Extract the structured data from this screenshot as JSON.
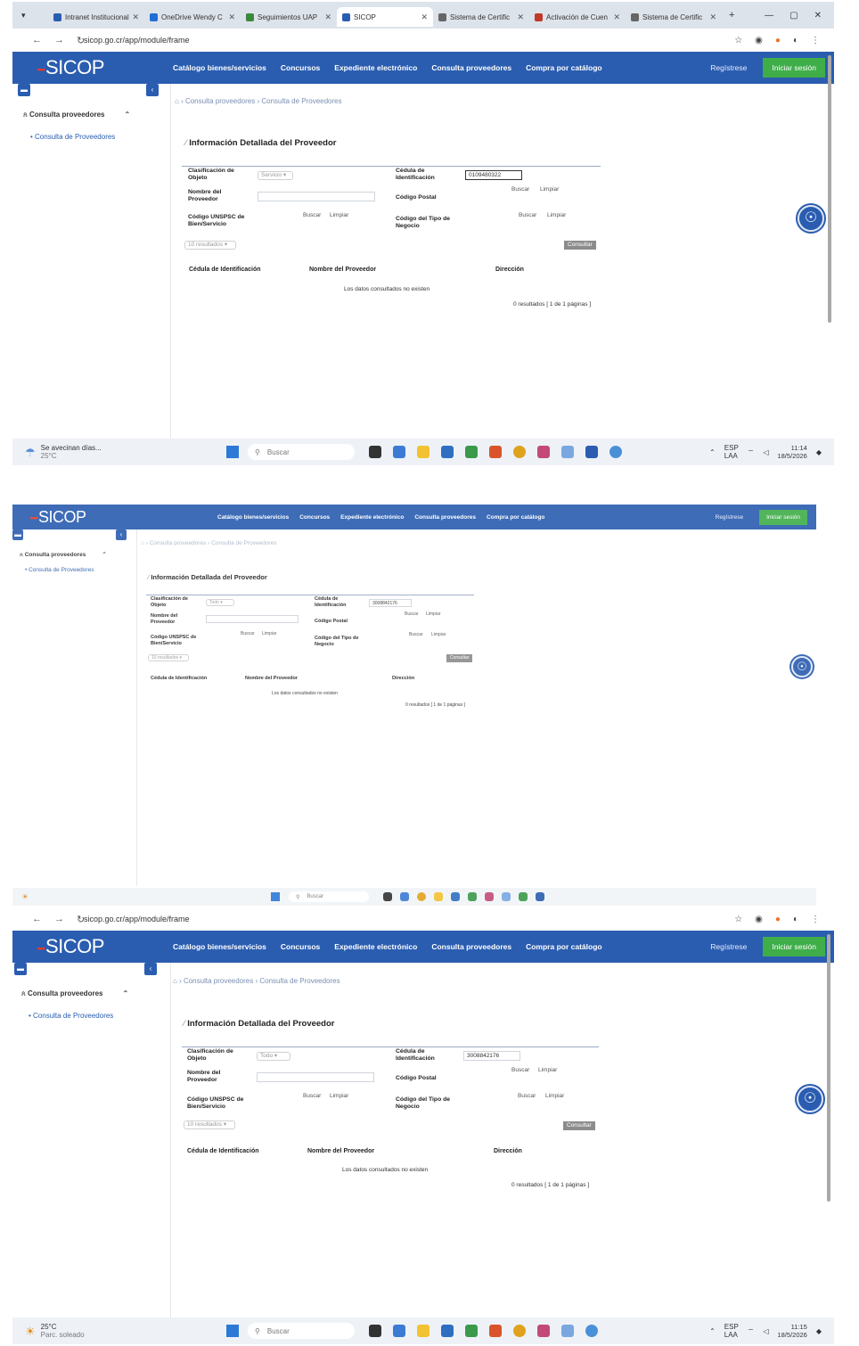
{
  "browser": {
    "tabs": [
      {
        "label": "Intranet Institucional",
        "color": "#2a5db0"
      },
      {
        "label": "OneDrive Wendy C",
        "color": "#1f6fd6"
      },
      {
        "label": "Seguimientos UAP",
        "color": "#3b8a3b"
      },
      {
        "label": "SICOP",
        "color": "#2a5db0"
      },
      {
        "label": "Sistema de Certific",
        "color": "#666666"
      },
      {
        "label": "Activación de Cuen",
        "color": "#c0392b"
      },
      {
        "label": "Sistema de Certific",
        "color": "#666666"
      }
    ],
    "url": "sicop.go.cr/app/module/frame"
  },
  "sicop": {
    "logo": "SICOP",
    "menu": [
      "Catálogo bienes/servicios",
      "Concursos",
      "Expediente electrónico",
      "Consulta proveedores",
      "Compra por catálogo"
    ],
    "register": "Regístrese",
    "login": "Iniciar sesión",
    "sidebar_section": "Consulta proveedores",
    "sidebar_link": "Consulta de Proveedores",
    "breadcrumb": [
      "Consulta proveedores",
      "Consulta de Proveedores"
    ],
    "page_title": "Información Detallada del Proveedor"
  },
  "form": {
    "clasificacion_label": "Clasificación de Objeto",
    "nombre_label": "Nombre del Proveedor",
    "unspsc_label": "Código UNSPSC de Bien/Servicio",
    "cedula_label": "Cédula de Identificación",
    "postal_label": "Código Postal",
    "tipo_label": "Código del Tipo de Negocio",
    "buscar": "Buscar",
    "limpiar": "Limpiar",
    "resultados_select": "10 resultados",
    "consultar": "Consultar"
  },
  "table": {
    "col_cedula": "Cédula de Identificación",
    "col_nombre": "Nombre del Proveedor",
    "col_direccion": "Dirección",
    "empty": "Los datos consultados no existen",
    "results_summary": "0 resultados [ 1 de 1 páginas ]"
  },
  "screens": [
    {
      "clasificacion_value": "Servicio",
      "cedula_value": "0109480322"
    },
    {
      "clasificacion_value": "Todo",
      "cedula_value": "3008842176"
    },
    {
      "clasificacion_value": "Todo",
      "cedula_value": "3008842176"
    }
  ],
  "taskbar": {
    "weather_1": "Se avecinan días...",
    "weather_1_temp": "25°C",
    "weather_3": "25°C",
    "weather_3_sub": "Parc. soleado",
    "search": "Buscar",
    "lang": "ESP",
    "lang_sub": "LAA",
    "time_1": "11:14",
    "time_3": "11:15",
    "date": "18/5/2026"
  }
}
